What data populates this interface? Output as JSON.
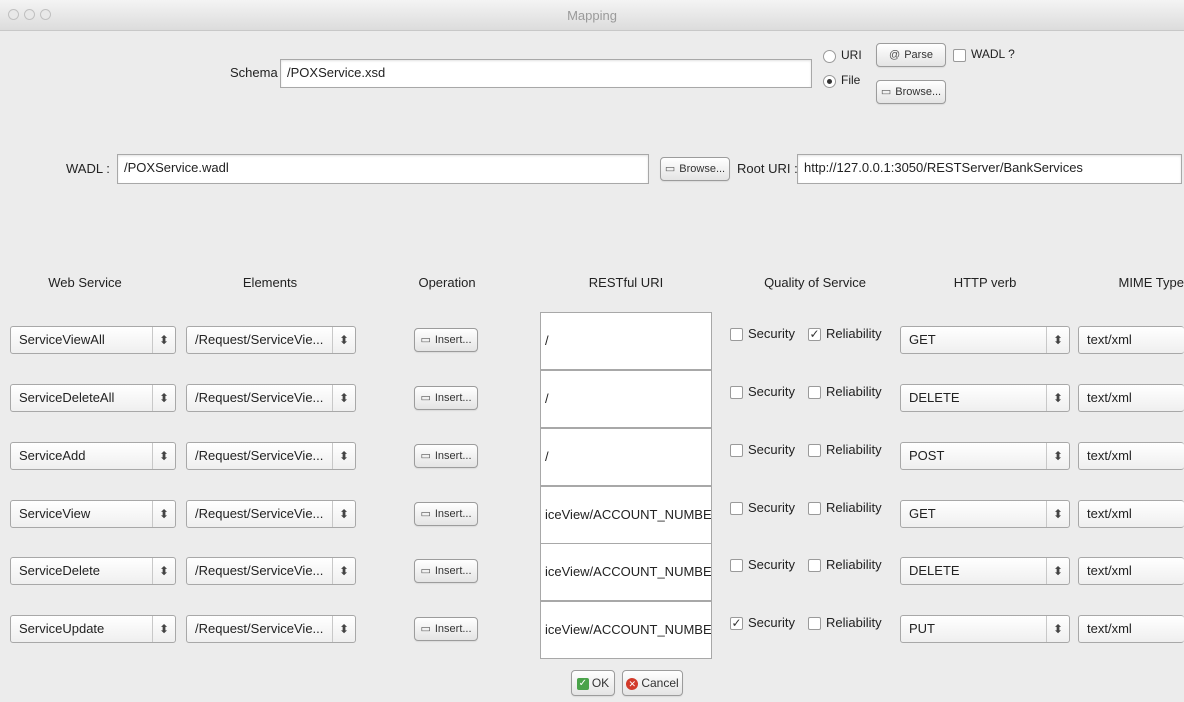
{
  "window": {
    "title": "Mapping"
  },
  "schema": {
    "label": "Schema",
    "value": "/POXService.xsd",
    "uri_label": "URI",
    "file_label": "File",
    "source_selected": "File",
    "parse_label": "Parse",
    "browse_label": "Browse...",
    "wadl_check_label": "WADL ?",
    "wadl_checked": false
  },
  "wadl": {
    "label": "WADL :",
    "value": "/POXService.wadl",
    "browse_label": "Browse...",
    "root_uri_label": "Root URI :",
    "root_uri_value": "http://127.0.0.1:3050/RESTServer/BankServices"
  },
  "columns": {
    "web_service": "Web Service",
    "elements": "Elements",
    "operation": "Operation",
    "restful_uri": "RESTful URI",
    "qos": "Quality of Service",
    "http_verb": "HTTP verb",
    "mime_type": "MIME Type"
  },
  "rows": [
    {
      "service": "ServiceViewAll",
      "element": "/Request/ServiceVie...",
      "insert": "Insert...",
      "uri": "/",
      "security_label": "Security",
      "security": false,
      "reliability_label": "Reliability",
      "reliability": true,
      "verb": "GET",
      "mime": "text/xml"
    },
    {
      "service": "ServiceDeleteAll",
      "element": "/Request/ServiceVie...",
      "insert": "Insert...",
      "uri": "/",
      "security_label": "Security",
      "security": false,
      "reliability_label": "Reliability",
      "reliability": false,
      "verb": "DELETE",
      "mime": "text/xml"
    },
    {
      "service": "ServiceAdd",
      "element": "/Request/ServiceVie...",
      "insert": "Insert...",
      "uri": "/",
      "security_label": "Security",
      "security": false,
      "reliability_label": "Reliability",
      "reliability": false,
      "verb": "POST",
      "mime": "text/xml"
    },
    {
      "service": "ServiceView",
      "element": "/Request/ServiceVie...",
      "insert": "Insert...",
      "uri": "iceView/ACCOUNT_NUMBER}",
      "security_label": "Security",
      "security": false,
      "reliability_label": "Reliability",
      "reliability": false,
      "verb": "GET",
      "mime": "text/xml"
    },
    {
      "service": "ServiceDelete",
      "element": "/Request/ServiceVie...",
      "insert": "Insert...",
      "uri": "iceView/ACCOUNT_NUMBER}",
      "security_label": "Security",
      "security": false,
      "reliability_label": "Reliability",
      "reliability": false,
      "verb": "DELETE",
      "mime": "text/xml"
    },
    {
      "service": "ServiceUpdate",
      "element": "/Request/ServiceVie...",
      "insert": "Insert...",
      "uri": "iceView/ACCOUNT_NUMBER}",
      "security_label": "Security",
      "security": true,
      "reliability_label": "Reliability",
      "reliability": false,
      "verb": "PUT",
      "mime": "text/xml"
    }
  ],
  "footer": {
    "ok_label": "OK",
    "cancel_label": "Cancel"
  },
  "icons": {
    "parse": "parse-icon",
    "browse": "folder-icon",
    "insert": "folder-icon",
    "ok": "checkmark-icon",
    "cancel": "cancel-icon",
    "select": "up-down-arrows-icon"
  },
  "colors": {
    "ok": "#4aa34a",
    "cancel": "#d23a2a"
  }
}
